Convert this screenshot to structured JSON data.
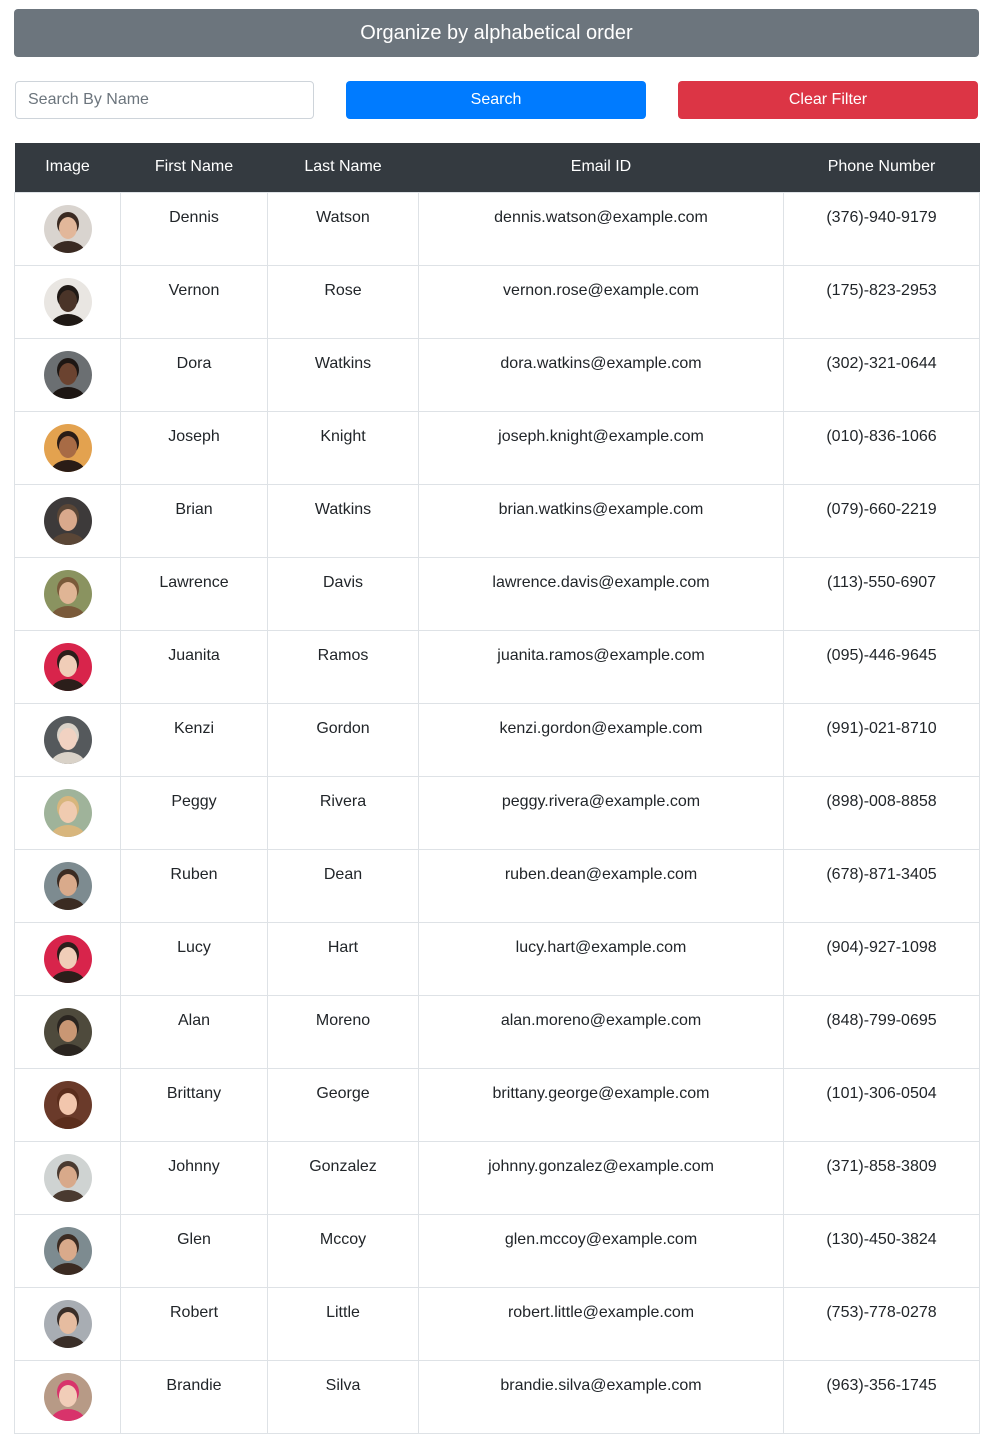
{
  "header": {
    "organize_label": "Organize by alphabetical order"
  },
  "search": {
    "placeholder": "Search By Name",
    "value": "",
    "search_label": "Search",
    "clear_label": "Clear Filter"
  },
  "table": {
    "columns": [
      "Image",
      "First Name",
      "Last Name",
      "Email ID",
      "Phone Number"
    ],
    "rows": [
      {
        "first": "Dennis",
        "last": "Watson",
        "email": "dennis.watson@example.com",
        "phone": "(376)-940-9179",
        "avatar_bg": "#d9d4cf",
        "avatar_skin": "#e2b79a",
        "avatar_hair": "#3a2a22"
      },
      {
        "first": "Vernon",
        "last": "Rose",
        "email": "vernon.rose@example.com",
        "phone": "(175)-823-2953",
        "avatar_bg": "#e9e6e2",
        "avatar_skin": "#4a3428",
        "avatar_hair": "#1f1915"
      },
      {
        "first": "Dora",
        "last": "Watkins",
        "email": "dora.watkins@example.com",
        "phone": "(302)-321-0644",
        "avatar_bg": "#6b6f72",
        "avatar_skin": "#6b4330",
        "avatar_hair": "#1d1613"
      },
      {
        "first": "Joseph",
        "last": "Knight",
        "email": "joseph.knight@example.com",
        "phone": "(010)-836-1066",
        "avatar_bg": "#e3a24f",
        "avatar_skin": "#a86b45",
        "avatar_hair": "#2a1c16"
      },
      {
        "first": "Brian",
        "last": "Watkins",
        "email": "brian.watkins@example.com",
        "phone": "(079)-660-2219",
        "avatar_bg": "#3d3a3a",
        "avatar_skin": "#d9a98c",
        "avatar_hair": "#5a4636"
      },
      {
        "first": "Lawrence",
        "last": "Davis",
        "email": "lawrence.davis@example.com",
        "phone": "(113)-550-6907",
        "avatar_bg": "#8a9360",
        "avatar_skin": "#e0b595",
        "avatar_hair": "#7a5a3a"
      },
      {
        "first": "Juanita",
        "last": "Ramos",
        "email": "juanita.ramos@example.com",
        "phone": "(095)-446-9645",
        "avatar_bg": "#d8244b",
        "avatar_skin": "#f0cdb8",
        "avatar_hair": "#2b1e1a"
      },
      {
        "first": "Kenzi",
        "last": "Gordon",
        "email": "kenzi.gordon@example.com",
        "phone": "(991)-021-8710",
        "avatar_bg": "#55595c",
        "avatar_skin": "#f1d2c2",
        "avatar_hair": "#d9d2c8"
      },
      {
        "first": "Peggy",
        "last": "Rivera",
        "email": "peggy.rivera@example.com",
        "phone": "(898)-008-8858",
        "avatar_bg": "#9fb39a",
        "avatar_skin": "#f0cbb0",
        "avatar_hair": "#d8b67d"
      },
      {
        "first": "Ruben",
        "last": "Dean",
        "email": "ruben.dean@example.com",
        "phone": "(678)-871-3405",
        "avatar_bg": "#7d8b90",
        "avatar_skin": "#d9aa8b",
        "avatar_hair": "#3b2b22"
      },
      {
        "first": "Lucy",
        "last": "Hart",
        "email": "lucy.hart@example.com",
        "phone": "(904)-927-1098",
        "avatar_bg": "#d8244b",
        "avatar_skin": "#f0cdb8",
        "avatar_hair": "#2b1e1a"
      },
      {
        "first": "Alan",
        "last": "Moreno",
        "email": "alan.moreno@example.com",
        "phone": "(848)-799-0695",
        "avatar_bg": "#4e4a3c",
        "avatar_skin": "#c99774",
        "avatar_hair": "#2a2520"
      },
      {
        "first": "Brittany",
        "last": "George",
        "email": "brittany.george@example.com",
        "phone": "(101)-306-0504",
        "avatar_bg": "#6a3a2a",
        "avatar_skin": "#f2c6ad",
        "avatar_hair": "#5b2d1c"
      },
      {
        "first": "Johnny",
        "last": "Gonzalez",
        "email": "johnny.gonzalez@example.com",
        "phone": "(371)-858-3809",
        "avatar_bg": "#cfd3d2",
        "avatar_skin": "#d8a98a",
        "avatar_hair": "#4a3a30"
      },
      {
        "first": "Glen",
        "last": "Mccoy",
        "email": "glen.mccoy@example.com",
        "phone": "(130)-450-3824",
        "avatar_bg": "#7d8b90",
        "avatar_skin": "#d9aa8b",
        "avatar_hair": "#3b2b22"
      },
      {
        "first": "Robert",
        "last": "Little",
        "email": "robert.little@example.com",
        "phone": "(753)-778-0278",
        "avatar_bg": "#a8adb3",
        "avatar_skin": "#e6bca0",
        "avatar_hair": "#3a2e28"
      },
      {
        "first": "Brandie",
        "last": "Silva",
        "email": "brandie.silva@example.com",
        "phone": "(963)-356-1745",
        "avatar_bg": "#b79a86",
        "avatar_skin": "#f1cdb8",
        "avatar_hair": "#d8336b"
      }
    ]
  },
  "colors": {
    "organize_bg": "#6c757d",
    "search_bg": "#007bff",
    "clear_bg": "#dc3545",
    "table_header_bg": "#343a40"
  }
}
